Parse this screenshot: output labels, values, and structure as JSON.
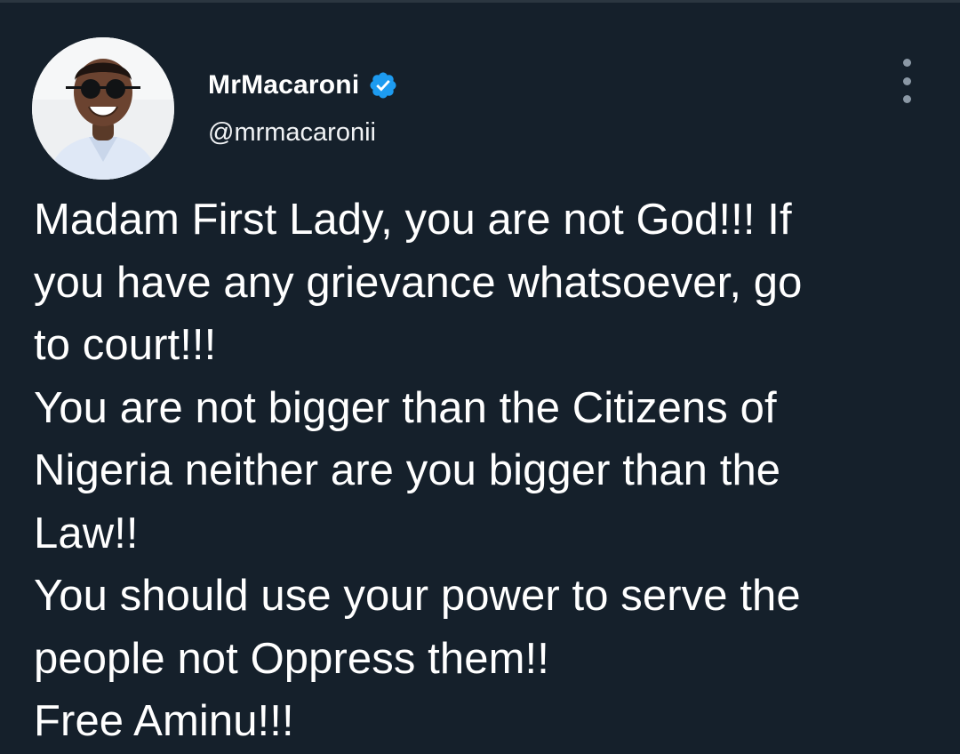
{
  "colors": {
    "background": "#15202b",
    "text": "#ffffff",
    "verified_badge": "#1d9bf0",
    "more_icon": "#8b98a5"
  },
  "author": {
    "display_name": "MrMacaroni",
    "handle": "@mrmacaronii",
    "verified_icon": "verified-badge-icon",
    "avatar_icon": "profile-avatar"
  },
  "menu": {
    "icon": "more-vertical-icon"
  },
  "tweet": {
    "lines": [
      "Madam First Lady, you are not God!!! If",
      "you have any grievance whatsoever, go",
      "to court!!!",
      "You are not bigger than the Citizens of",
      "Nigeria neither are you bigger than the",
      "Law!!",
      "You should use your power to serve the",
      "people not Oppress them!!",
      "Free Aminu!!!"
    ]
  }
}
